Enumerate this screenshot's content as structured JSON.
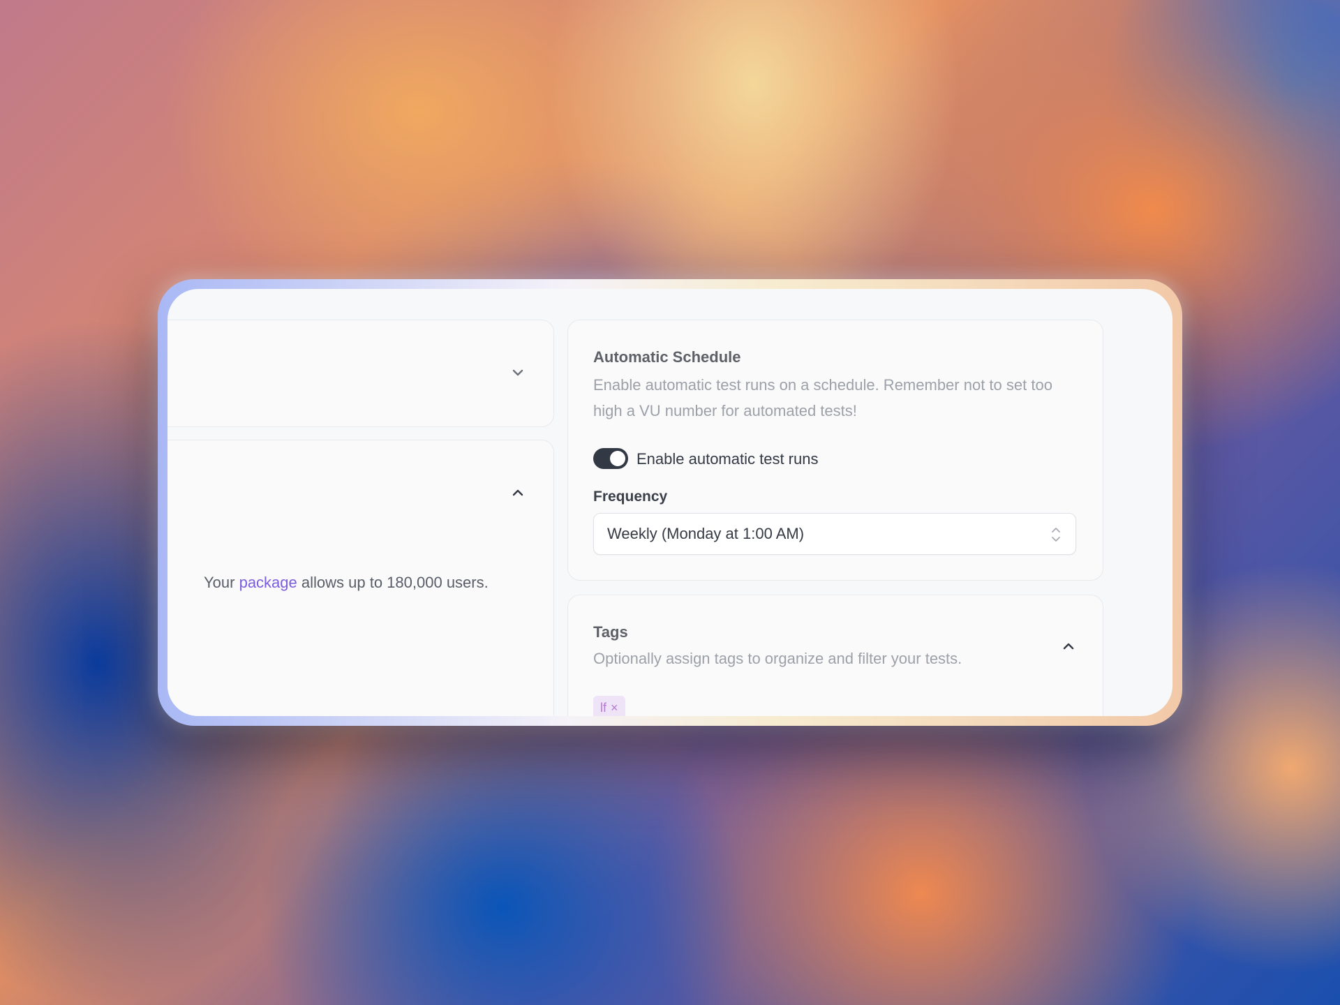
{
  "left": {
    "package_text_before": "Your",
    "package_link": "package",
    "package_text_after": "allows up to 180,000 users."
  },
  "schedule": {
    "title": "Automatic Schedule",
    "description_line1": "Enable automatic test runs on a schedule. Remember not to set too",
    "description_line2": "high a VU number for automated tests!",
    "toggle_label": "Enable automatic test runs",
    "toggle_on": true,
    "frequency_label": "Frequency",
    "frequency_value": "Weekly (Monday at 1:00 AM)"
  },
  "tags": {
    "title": "Tags",
    "description": "Optionally assign tags to organize and filter your tests.",
    "items": [
      {
        "label": "lf",
        "remove": "×"
      }
    ]
  },
  "icons": {
    "collapse": "chevron-down-icon",
    "expand": "chevron-up-icon",
    "select": "chevron-up-down-icon"
  },
  "colors": {
    "accent": "#7b5de0",
    "toggle": "#323844",
    "tag_bg": "#efe3f7",
    "tag_text": "#b57ad2"
  }
}
